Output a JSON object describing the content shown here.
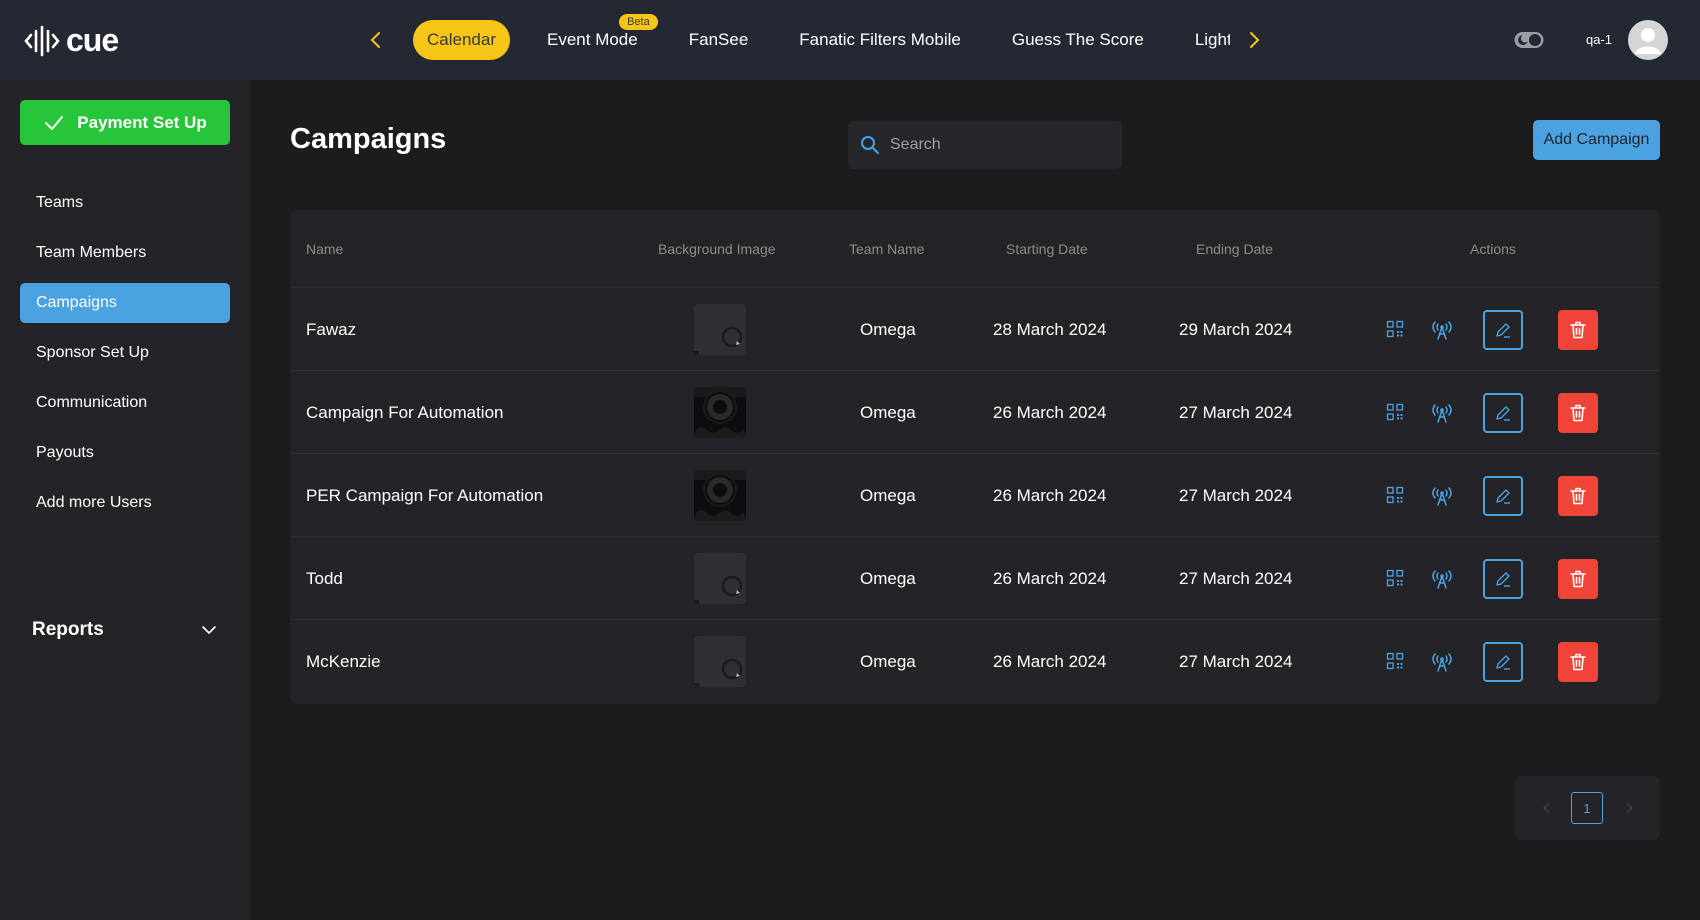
{
  "app": {
    "name": "cue"
  },
  "topnav": {
    "tabs": [
      {
        "label": "Calendar",
        "active": true
      },
      {
        "label": "Event Mode",
        "badge": "Beta"
      },
      {
        "label": "FanSee"
      },
      {
        "label": "Fanatic Filters Mobile"
      },
      {
        "label": "Guess The Score"
      },
      {
        "label": "Lighting"
      }
    ],
    "username": "qa-1"
  },
  "sidebar": {
    "payment_button": "Payment Set Up",
    "items": [
      {
        "label": "Teams"
      },
      {
        "label": "Team Members"
      },
      {
        "label": "Campaigns",
        "active": true
      },
      {
        "label": "Sponsor Set Up"
      },
      {
        "label": "Communication"
      },
      {
        "label": "Payouts"
      },
      {
        "label": "Add more Users"
      }
    ],
    "reports_label": "Reports"
  },
  "main": {
    "title": "Campaigns",
    "search": {
      "placeholder": "Search",
      "value": ""
    },
    "add_button": "Add Campaign",
    "table": {
      "headers": {
        "name": "Name",
        "bg_image": "Background Image",
        "team": "Team Name",
        "start": "Starting Date",
        "end": "Ending Date",
        "actions": "Actions"
      },
      "rows": [
        {
          "name": "Fawaz",
          "image": "placeholder",
          "team": "Omega",
          "start": "28 March 2024",
          "end": "29 March 2024"
        },
        {
          "name": "Campaign For Automation",
          "image": "dark-logo",
          "team": "Omega",
          "start": "26 March 2024",
          "end": "27 March 2024"
        },
        {
          "name": "PER Campaign For Automation",
          "image": "dark-logo",
          "team": "Omega",
          "start": "26 March 2024",
          "end": "27 March 2024"
        },
        {
          "name": "Todd",
          "image": "placeholder",
          "team": "Omega",
          "start": "26 March 2024",
          "end": "27 March 2024"
        },
        {
          "name": "McKenzie",
          "image": "placeholder",
          "team": "Omega",
          "start": "26 March 2024",
          "end": "27 March 2024"
        }
      ]
    },
    "pagination": {
      "current": "1"
    }
  },
  "colors": {
    "accent_blue": "#4aa3e0",
    "accent_yellow": "#f5c518",
    "success_green": "#26c53a",
    "danger_red": "#f04438"
  }
}
